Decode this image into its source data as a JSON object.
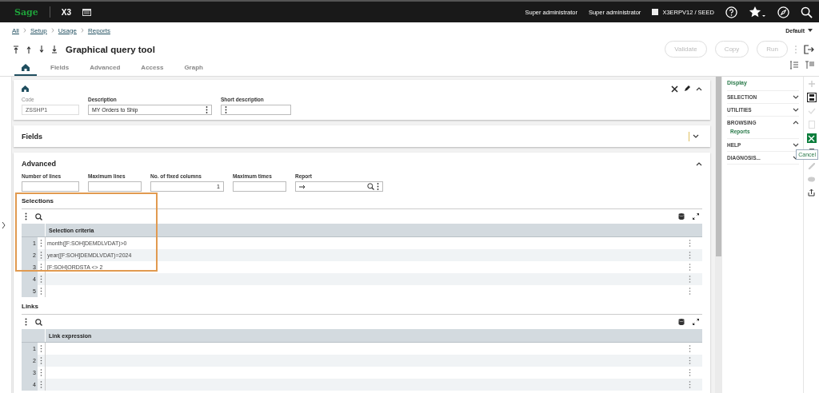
{
  "topbar": {
    "logo": "Sage",
    "product": "X3",
    "user": "Super administrator",
    "role": "Super administrator",
    "endpoint": "X3ERPV12 / SEED"
  },
  "breadcrumb": [
    "All",
    "Setup",
    "Usage",
    "Reports"
  ],
  "display_option": "Default",
  "title": "Graphical query tool",
  "action_buttons": [
    {
      "label": "Validate",
      "disabled": true
    },
    {
      "label": "Copy",
      "disabled": true
    },
    {
      "label": "Run",
      "disabled": true
    }
  ],
  "tabs": [
    {
      "kind": "home",
      "selected": true
    },
    {
      "kind": "text",
      "label": "Fields",
      "selected": false
    },
    {
      "kind": "text",
      "label": "Advanced",
      "selected": false
    },
    {
      "kind": "text",
      "label": "Access",
      "selected": false
    },
    {
      "kind": "text",
      "label": "Graph",
      "selected": false
    }
  ],
  "header_fields": [
    {
      "label": "Code",
      "value": "ZSSHP1",
      "disabled": true,
      "menu": false
    },
    {
      "label": "Description",
      "value": "MY Orders to Ship",
      "disabled": false,
      "menu": true
    },
    {
      "label": "Short description",
      "disabled": false,
      "menu": true
    }
  ],
  "fields_section": {
    "title": "Fields",
    "expanded": false
  },
  "advanced_section": {
    "title": "Advanced",
    "expanded": true
  },
  "advanced_fields": [
    {
      "label": "Number of lines",
      "kind": "text"
    },
    {
      "label": "Maximum lines",
      "kind": "text"
    },
    {
      "label": "No. of fixed columns",
      "value": "1",
      "kind": "number"
    },
    {
      "label": "Maximum times",
      "kind": "text"
    },
    {
      "label": "Report",
      "kind": "lookup"
    }
  ],
  "selections": {
    "title": "Selections",
    "column": "Selection criteria",
    "highlighted": true,
    "rows": [
      {
        "num": "1",
        "value": "month([F:SOH]DEMDLVDAT)>0"
      },
      {
        "num": "2",
        "value": "year([F:SOH]DEMDLVDAT)=2024"
      },
      {
        "num": "3",
        "value": "[F:SOH]ORDSTA <> 2"
      },
      {
        "num": "4"
      },
      {
        "num": "5"
      }
    ]
  },
  "links": {
    "title": "Links",
    "column": "Link expression",
    "rows": [
      {
        "num": "1"
      },
      {
        "num": "2"
      },
      {
        "num": "3"
      },
      {
        "num": "4"
      }
    ]
  },
  "side_panel": {
    "display": "Display",
    "items": [
      {
        "label": "SELECTION",
        "expanded": false
      },
      {
        "label": "UTILITIES",
        "expanded": false
      },
      {
        "label": "BROWSING",
        "expanded": true,
        "children": [
          "Reports"
        ]
      },
      {
        "label": "HELP",
        "expanded": false
      },
      {
        "label": "DIAGNOSIS...",
        "expanded": false
      }
    ]
  },
  "tooltip": "Cancel"
}
